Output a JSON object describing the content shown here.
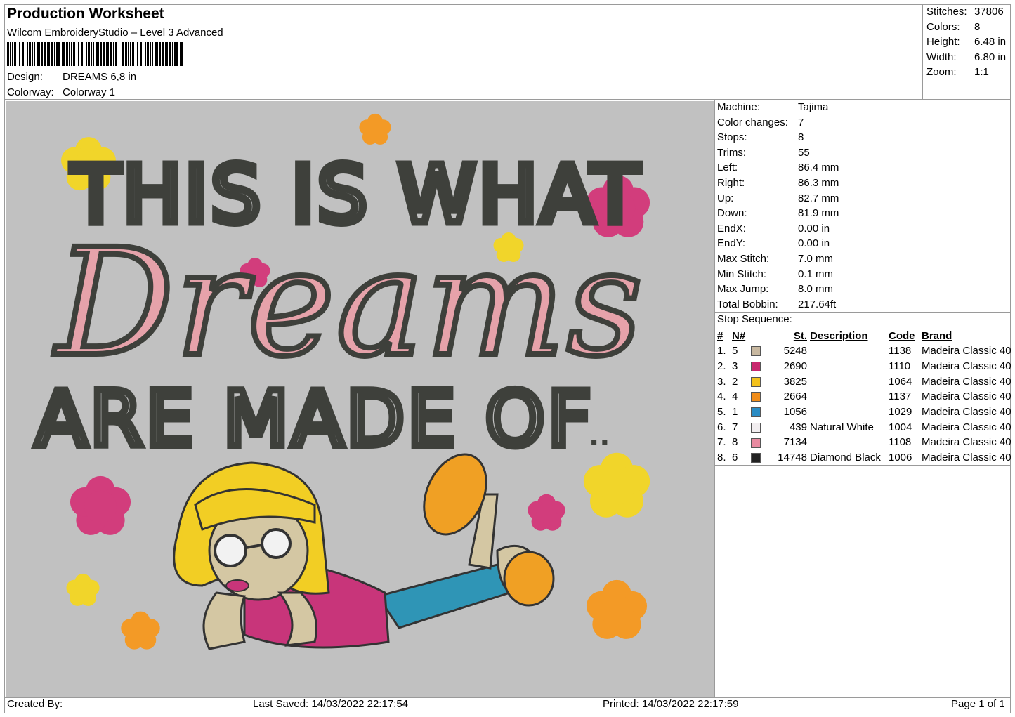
{
  "header": {
    "title": "Production Worksheet",
    "software": "Wilcom EmbroideryStudio – Level 3 Advanced",
    "design_label": "Design:",
    "design_value": "DREAMS 6,8 in",
    "colorway_label": "Colorway:",
    "colorway_value": "Colorway 1"
  },
  "stats": [
    {
      "label": "Stitches:",
      "value": "37806"
    },
    {
      "label": "Colors:",
      "value": "8"
    },
    {
      "label": "Height:",
      "value": "6.48 in"
    },
    {
      "label": "Width:",
      "value": "6.80 in"
    },
    {
      "label": "Zoom:",
      "value": "1:1"
    }
  ],
  "design_text": {
    "line1": "THIS IS WHAT",
    "line2": "Dreams",
    "line3": "ARE MADE OF",
    "ellipsis": ".."
  },
  "machine_info": [
    {
      "label": "Machine:",
      "value": "Tajima"
    },
    {
      "label": "Color changes:",
      "value": "7"
    },
    {
      "label": "Stops:",
      "value": "8"
    },
    {
      "label": "Trims:",
      "value": "55"
    },
    {
      "label": "Left:",
      "value": "86.4 mm"
    },
    {
      "label": "Right:",
      "value": "86.3 mm"
    },
    {
      "label": "Up:",
      "value": "82.7 mm"
    },
    {
      "label": "Down:",
      "value": "81.9 mm"
    },
    {
      "label": "EndX:",
      "value": "0.00 in"
    },
    {
      "label": "EndY:",
      "value": "0.00 in"
    },
    {
      "label": "Max Stitch:",
      "value": "7.0 mm"
    },
    {
      "label": "Min Stitch:",
      "value": "0.1 mm"
    },
    {
      "label": "Max Jump:",
      "value": "8.0 mm"
    },
    {
      "label": "Total Bobbin:",
      "value": "217.64ft"
    }
  ],
  "stop_sequence": {
    "title": "Stop Sequence:",
    "headers": {
      "idx": "#",
      "n": "N#",
      "st": "St.",
      "desc": "Description",
      "code": "Code",
      "brand": "Brand"
    },
    "rows": [
      {
        "idx": "1.",
        "n": "5",
        "color": "#c8b8a0",
        "st": "5248",
        "desc": "",
        "code": "1138",
        "brand": "Madeira Classic 40"
      },
      {
        "idx": "2.",
        "n": "3",
        "color": "#c8286e",
        "st": "2690",
        "desc": "",
        "code": "1110",
        "brand": "Madeira Classic 40"
      },
      {
        "idx": "3.",
        "n": "2",
        "color": "#f4c21c",
        "st": "3825",
        "desc": "",
        "code": "1064",
        "brand": "Madeira Classic 40"
      },
      {
        "idx": "4.",
        "n": "4",
        "color": "#f08c1a",
        "st": "2664",
        "desc": "",
        "code": "1137",
        "brand": "Madeira Classic 40"
      },
      {
        "idx": "5.",
        "n": "1",
        "color": "#2a8cc4",
        "st": "1056",
        "desc": "",
        "code": "1029",
        "brand": "Madeira Classic 40"
      },
      {
        "idx": "6.",
        "n": "7",
        "color": "#f2eef0",
        "st": "439",
        "desc": "Natural White",
        "code": "1004",
        "brand": "Madeira Classic 40"
      },
      {
        "idx": "7.",
        "n": "8",
        "color": "#e88aa0",
        "st": "7134",
        "desc": "",
        "code": "1108",
        "brand": "Madeira Classic 40"
      },
      {
        "idx": "8.",
        "n": "6",
        "color": "#222222",
        "st": "14748",
        "desc": "Diamond Black",
        "code": "1006",
        "brand": "Madeira Classic 40"
      }
    ]
  },
  "footer": {
    "created_by": "Created By:",
    "last_saved": "Last Saved: 14/03/2022 22:17:54",
    "printed": "Printed: 14/03/2022 22:17:59",
    "page": "Page 1 of 1"
  }
}
